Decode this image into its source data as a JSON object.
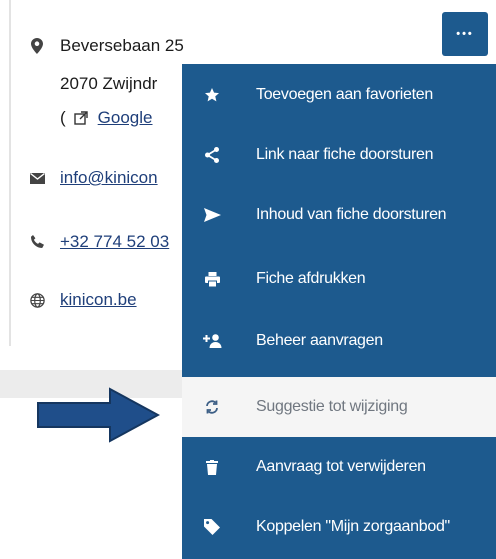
{
  "contact": {
    "address_line1": "Beversebaan 25",
    "address_line2": "2070 Zwijndr",
    "maps_prefix": "(",
    "maps_link": "Google",
    "email": "info@kinicon",
    "phone": "+32 774 52 03",
    "website": "kinicon.be"
  },
  "more_button": {
    "label": "•••"
  },
  "menu": {
    "items": [
      {
        "label": "Toevoegen aan favorieten",
        "icon": "star-icon"
      },
      {
        "label": "Link naar fiche doorsturen",
        "icon": "share-icon"
      },
      {
        "label": "Inhoud van fiche doorsturen",
        "icon": "send-icon"
      },
      {
        "label": "Fiche afdrukken",
        "icon": "print-icon"
      },
      {
        "label": "Beheer aanvragen",
        "icon": "add-user-icon"
      },
      {
        "label": "Suggestie tot wijziging",
        "icon": "sync-icon"
      },
      {
        "label": "Aanvraag tot verwijderen",
        "icon": "trash-icon"
      },
      {
        "label": "Koppelen \"Mijn zorgaanbod\"",
        "icon": "tag-icon"
      }
    ],
    "active_index": 5
  },
  "colors": {
    "menu_bg": "#1d5a8e",
    "active_bg": "#f5f5f5",
    "arrow": "#1f4e8a",
    "link": "#1f3f7a"
  }
}
